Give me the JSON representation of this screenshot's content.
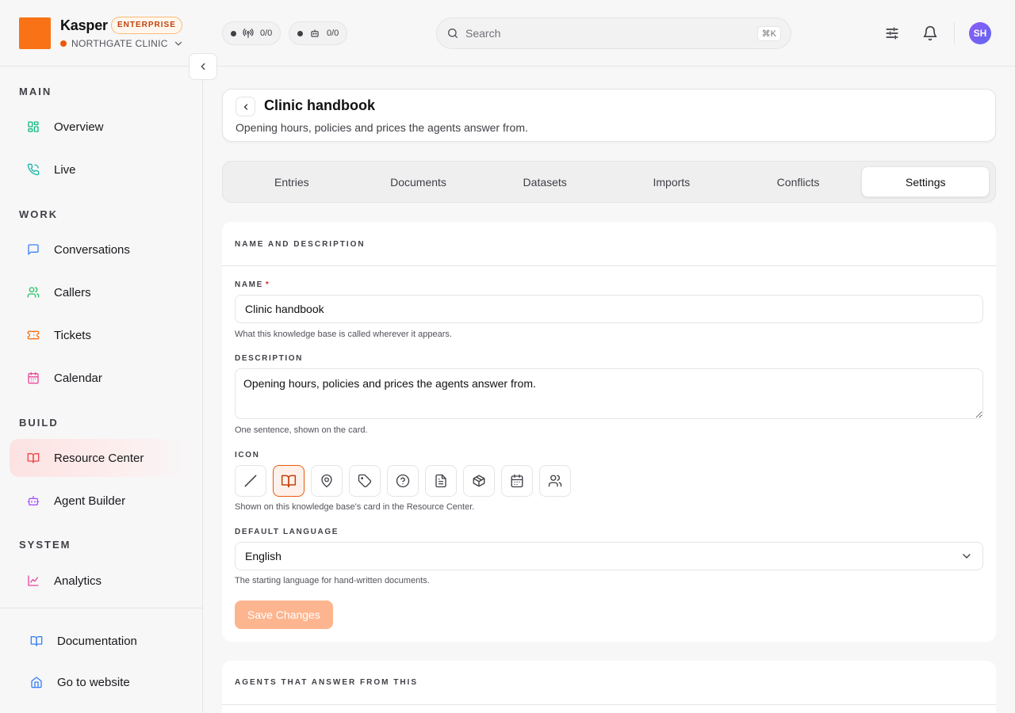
{
  "app": {
    "name": "Kasper",
    "plan_badge": "ENTERPRISE",
    "org_name": "NORTHGATE CLINIC",
    "brand_color": "#f97316"
  },
  "topbar": {
    "status": [
      {
        "icon": "broadcast-icon",
        "value": "0/0"
      },
      {
        "icon": "robot-icon",
        "value": "0/0"
      }
    ],
    "search": {
      "placeholder": "Search",
      "shortcut": "⌘K"
    },
    "icons": [
      "sliders-icon",
      "bell-icon"
    ],
    "avatar_initials": "SH"
  },
  "sidebar": {
    "sections": [
      {
        "label": "MAIN",
        "items": [
          {
            "label": "Overview",
            "icon": "dashboard-icon",
            "color": "#10b981"
          },
          {
            "label": "Live",
            "icon": "phone-icon",
            "color": "#14b8a6"
          }
        ]
      },
      {
        "label": "WORK",
        "items": [
          {
            "label": "Conversations",
            "icon": "chat-icon",
            "color": "#3b82f6"
          },
          {
            "label": "Callers",
            "icon": "users-icon",
            "color": "#22c55e"
          },
          {
            "label": "Tickets",
            "icon": "ticket-icon",
            "color": "#f97316"
          },
          {
            "label": "Calendar",
            "icon": "calendar-icon",
            "color": "#ec4899"
          }
        ]
      },
      {
        "label": "BUILD",
        "items": [
          {
            "label": "Resource Center",
            "icon": "book-icon",
            "color": "#ef4444",
            "active": true
          },
          {
            "label": "Agent Builder",
            "icon": "robot-icon",
            "color": "#a855f7"
          }
        ]
      },
      {
        "label": "SYSTEM",
        "items": [
          {
            "label": "Analytics",
            "icon": "chart-icon",
            "color": "#ec4899"
          }
        ]
      }
    ],
    "bottom": [
      {
        "label": "Documentation",
        "icon": "book-icon",
        "color": "#3b82f6"
      },
      {
        "label": "Go to website",
        "icon": "home-icon",
        "color": "#3b82f6"
      }
    ]
  },
  "page": {
    "title": "Clinic handbook",
    "subtitle": "Opening hours, policies and prices the agents answer from."
  },
  "tabs": [
    "Entries",
    "Documents",
    "Datasets",
    "Imports",
    "Conflicts",
    "Settings"
  ],
  "active_tab": "Settings",
  "settings": {
    "section_title": "NAME AND DESCRIPTION",
    "name_label": "NAME",
    "name_required": "*",
    "name_value": "Clinic handbook",
    "name_help": "What this knowledge base is called wherever it appears.",
    "description_label": "DESCRIPTION",
    "description_value": "Opening hours, policies and prices the agents answer from.",
    "description_help": "One sentence, shown on the card.",
    "icon_label": "ICON",
    "icon_options": [
      "none-icon",
      "book-icon",
      "map-pin-icon",
      "tag-icon",
      "help-circle-icon",
      "document-icon",
      "box-icon",
      "calendar-icon",
      "users-icon"
    ],
    "icon_selected": "book-icon",
    "icon_help": "Shown on this knowledge base's card in the Resource Center.",
    "language_label": "DEFAULT LANGUAGE",
    "language_value": "English",
    "language_help": "The starting language for hand-written documents.",
    "save_label": "Save Changes",
    "accent_color": "#ea580c"
  },
  "agents_section": {
    "title": "AGENTS THAT ANSWER FROM THIS"
  }
}
